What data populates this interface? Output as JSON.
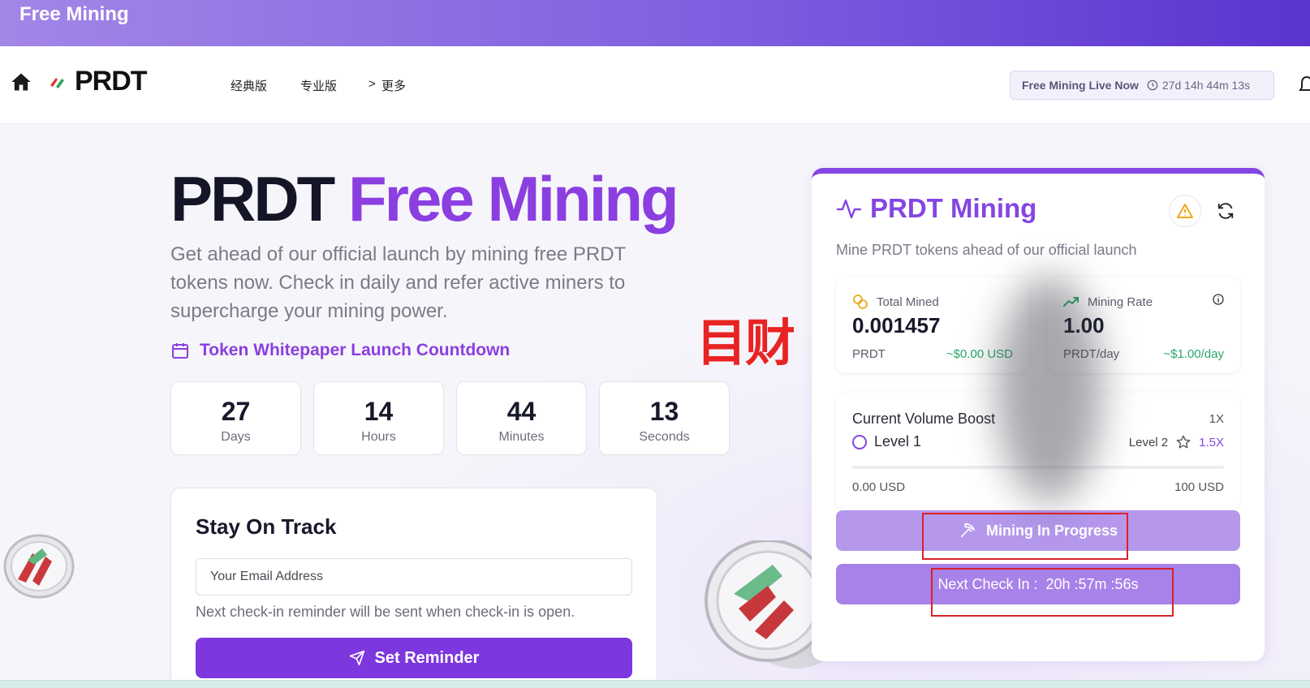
{
  "banner": {
    "title": "Free Mining"
  },
  "nav": {
    "logo_text": "PRDT",
    "links": [
      "经典版",
      "专业版",
      "更多"
    ],
    "more_chevron": ">",
    "live_label": "Free Mining Live Now",
    "live_countdown": "27d 14h 44m 13s"
  },
  "hero": {
    "title_plain": "PRDT",
    "title_accent": "Free Mining",
    "description": "Get ahead of our official launch by mining free PRDT tokens now. Check in daily and refer active miners to supercharge your mining power.",
    "whitepaper_label": "Token Whitepaper Launch Countdown",
    "countdown": [
      {
        "value": "27",
        "label": "Days"
      },
      {
        "value": "14",
        "label": "Hours"
      },
      {
        "value": "44",
        "label": "Minutes"
      },
      {
        "value": "13",
        "label": "Seconds"
      }
    ]
  },
  "overlay_text": "目财",
  "track": {
    "heading": "Stay On Track",
    "email_placeholder": "Your Email Address",
    "note": "Next check-in reminder will be sent when check-in is open.",
    "button_label": "Set Reminder"
  },
  "mining": {
    "title": "PRDT Mining",
    "subtitle": "Mine PRDT tokens ahead of our official launch",
    "total_mined": {
      "label": "Total Mined",
      "value": "0.001457",
      "unit": "PRDT",
      "usd": "~$0.00 USD"
    },
    "mining_rate": {
      "label": "Mining Rate",
      "value": "1.00",
      "unit": "PRDT/day",
      "usd": "~$1.00/day"
    },
    "boost": {
      "heading": "Current Volume Boost",
      "current_multiplier": "1X",
      "current_level": "Level 1",
      "next_level": "Level 2",
      "next_multiplier": "1.5X",
      "min_label": "0.00 USD",
      "max_label": "100 USD",
      "progress": 0
    },
    "progress_button": "Mining In Progress",
    "checkin_button": "Next Check In :  20h :57m :56s"
  },
  "colors": {
    "accent": "#8446e2",
    "success": "#2aa66a",
    "highlight_box": "#d8222a"
  }
}
